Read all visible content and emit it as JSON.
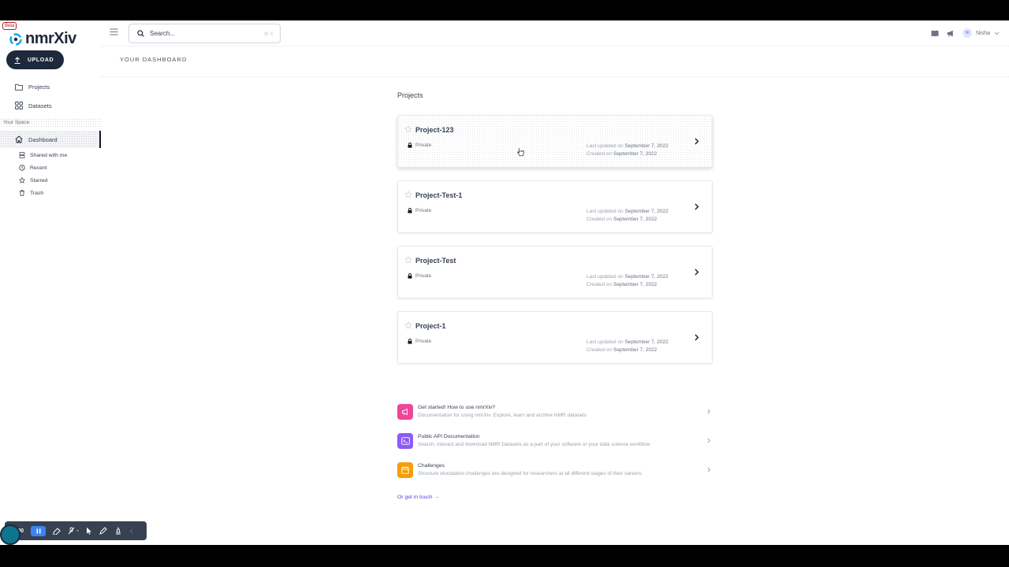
{
  "app": {
    "name": "nmrXiv",
    "badge": "Beta"
  },
  "sidebar": {
    "upload_label": "UPLOAD",
    "items": [
      {
        "label": "Projects"
      },
      {
        "label": "Datasets"
      }
    ],
    "section_label": "Your Space",
    "space_items": [
      {
        "label": "Dashboard",
        "active": true
      },
      {
        "label": "Shared with me"
      },
      {
        "label": "Recent"
      },
      {
        "label": "Starred"
      },
      {
        "label": "Trash"
      }
    ]
  },
  "topbar": {
    "search_placeholder": "Search...",
    "search_shortcut": "⌘ K",
    "user_initials": "NI",
    "user_name": "Nisha"
  },
  "breadcrumb": "YOUR DASHBOARD",
  "projects": {
    "heading": "Projects",
    "items": [
      {
        "name": "Project-123",
        "visibility": "Private",
        "updated_prefix": "Last updated on",
        "updated": "September 7, 2022",
        "created_prefix": "Created on",
        "created": "September 7, 2022"
      },
      {
        "name": "Project-Test-1",
        "visibility": "Private",
        "updated_prefix": "Last updated on",
        "updated": "September 7, 2022",
        "created_prefix": "Created on",
        "created": "September 7, 2022"
      },
      {
        "name": "Project-Test",
        "visibility": "Private",
        "updated_prefix": "Last updated on",
        "updated": "September 7, 2022",
        "created_prefix": "Created on",
        "created": "September 7, 2022"
      },
      {
        "name": "Project-1",
        "visibility": "Private",
        "updated_prefix": "Last updated on",
        "updated": "September 7, 2022",
        "created_prefix": "Created on",
        "created": "September 7, 2022"
      }
    ]
  },
  "resources": [
    {
      "title": "Get started! How to use nmrXiv?",
      "desc": "Documentation for using nmrXiv. Explore, learn and archive NMR datasets",
      "color": "#ec4899"
    },
    {
      "title": "Public API Documentation",
      "desc": "Search, interact and download NMR Datasets as a part of your software or your data science workflow",
      "color": "#8b5cf6"
    },
    {
      "title": "Challenges",
      "desc": "Structure elucidation challenges are designed for researchers at all different stages of their careers",
      "color": "#f59e0b"
    }
  ],
  "contact_link": "Or get in touch →",
  "recorder": {
    "time": "0:00"
  },
  "colors": {
    "sidebar_active_bar": "#111827",
    "upload_bg": "#1e293b",
    "link": "#4f46e5"
  }
}
